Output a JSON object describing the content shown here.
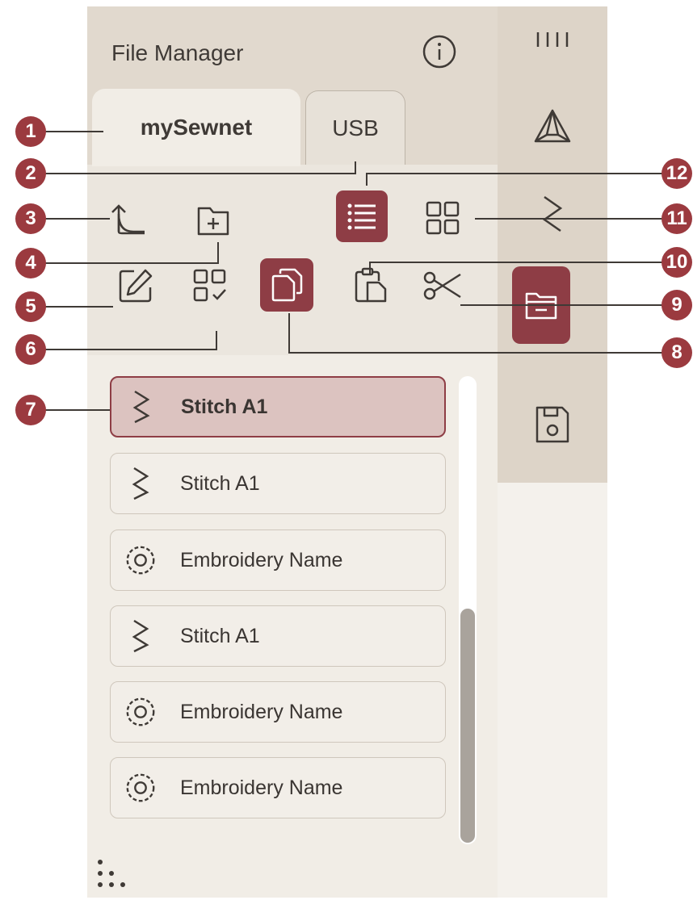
{
  "header": {
    "title": "File Manager"
  },
  "tabs": [
    {
      "label": "mySewnet",
      "active": true
    },
    {
      "label": "USB",
      "active": false
    }
  ],
  "toolbar": {
    "up_folder": "up-folder-icon",
    "new_folder": "new-folder-icon",
    "list_view": {
      "icon": "list-view-icon",
      "selected": true
    },
    "thumbnail_view": {
      "icon": "thumbnail-view-icon",
      "selected": false
    },
    "rename": "rename-icon",
    "multi_select": "multi-select-icon",
    "copy": {
      "icon": "copy-icon",
      "selected": true
    },
    "paste": "paste-icon",
    "cut": "cut-icon"
  },
  "rail": [
    {
      "icon": "grip-icon"
    },
    {
      "icon": "embroidery-mode-icon"
    },
    {
      "icon": "stitch-icon"
    },
    {
      "icon": "file-manager-icon",
      "selected": true
    },
    {
      "icon": "save-icon"
    }
  ],
  "files": [
    {
      "name": "Stitch A1",
      "type": "stitch",
      "selected": true
    },
    {
      "name": "Stitch A1",
      "type": "stitch",
      "selected": false
    },
    {
      "name": "Embroidery Name",
      "type": "embroidery",
      "selected": false
    },
    {
      "name": "Stitch A1",
      "type": "stitch",
      "selected": false
    },
    {
      "name": "Embroidery Name",
      "type": "embroidery",
      "selected": false
    },
    {
      "name": "Embroidery Name",
      "type": "embroidery",
      "selected": false
    }
  ],
  "scrollbar": {
    "thumb_start": 0.5,
    "thumb_size": 0.5
  },
  "callouts": [
    "1",
    "2",
    "3",
    "4",
    "5",
    "6",
    "7",
    "8",
    "9",
    "10",
    "11",
    "12"
  ],
  "colors": {
    "accent": "#8e3d45",
    "callout": "#9b3a3f",
    "panel": "#e1d9ce",
    "content": "#f1ede6"
  }
}
